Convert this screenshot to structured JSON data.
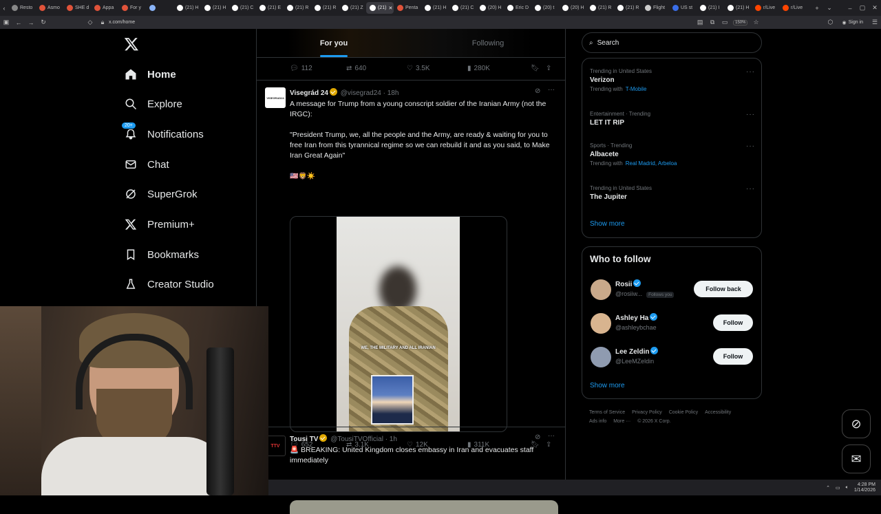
{
  "browser": {
    "tabs": [
      {
        "label": "Resto",
        "color": "#888"
      },
      {
        "label": "Asmo",
        "color": "#e0533a"
      },
      {
        "label": "SHE d",
        "color": "#e0533a"
      },
      {
        "label": "Appa",
        "color": "#e0533a"
      },
      {
        "label": "For y",
        "color": "#e0533a"
      },
      {
        "label": "",
        "color": "#8ab4f8"
      },
      {
        "label": "(21) H",
        "color": "#fff"
      },
      {
        "label": "(21) H",
        "color": "#fff"
      },
      {
        "label": "(21) C",
        "color": "#fff"
      },
      {
        "label": "(21) E",
        "color": "#fff"
      },
      {
        "label": "(21) R",
        "color": "#fff"
      },
      {
        "label": "(21) R",
        "color": "#fff"
      },
      {
        "label": "(21) Z",
        "color": "#fff"
      },
      {
        "label": "(21)",
        "color": "#fff",
        "active": true
      },
      {
        "label": "Penta",
        "color": "#e0533a"
      },
      {
        "label": "(21) H",
        "color": "#fff"
      },
      {
        "label": "(21) C",
        "color": "#fff"
      },
      {
        "label": "(20) H",
        "color": "#fff"
      },
      {
        "label": "Eric D",
        "color": "#fff"
      },
      {
        "label": "(20) t",
        "color": "#fff"
      },
      {
        "label": "(20) H",
        "color": "#fff"
      },
      {
        "label": "(21) R",
        "color": "#fff"
      },
      {
        "label": "(21) R",
        "color": "#fff"
      },
      {
        "label": "Flight",
        "color": "#ccc"
      },
      {
        "label": "US st",
        "color": "#3a6ee8"
      },
      {
        "label": "(21) I",
        "color": "#fff"
      },
      {
        "label": "(21) H",
        "color": "#fff"
      },
      {
        "label": "r/Live",
        "color": "#ff4500"
      },
      {
        "label": "r/Live",
        "color": "#ff4500"
      }
    ],
    "url": "x.com/home",
    "zoom": "150%",
    "signin": "Sign in"
  },
  "nav": {
    "items": [
      {
        "label": "Home",
        "icon": "home-icon"
      },
      {
        "label": "Explore",
        "icon": "search-icon"
      },
      {
        "label": "Notifications",
        "icon": "bell-icon",
        "badge": "20+"
      },
      {
        "label": "Chat",
        "icon": "mail-icon"
      },
      {
        "label": "SuperGrok",
        "icon": "grok-icon"
      },
      {
        "label": "Premium+",
        "icon": "x-icon"
      },
      {
        "label": "Bookmarks",
        "icon": "bookmark-icon"
      },
      {
        "label": "Creator Studio",
        "icon": "flask-icon"
      }
    ]
  },
  "feed": {
    "tabs": [
      "For you",
      "Following"
    ],
    "prev_actions": {
      "replies": "112",
      "reposts": "640",
      "likes": "3.5K",
      "views": "280K"
    },
    "post1": {
      "name": "Visegrád 24",
      "handle": "@visegrad24",
      "time": "· 18h",
      "avatar_text": "VISEGRAD24",
      "text1": "A message for Trump from a young conscript soldier of the Iranian Army (not the IRGC):",
      "text2": "\"President Trump, we, all the people and the Army, are ready & waiting for you to free Iran from this tyrannical regime so we can rebuild it and as you said, to Make Iran Great Again\"",
      "emojis": "🇺🇸🦁☀️",
      "video_caption": "WE, THE MILITARY AND ALL IRANIAN",
      "actions": {
        "replies": "652",
        "reposts": "3.1K",
        "likes": "12K",
        "views": "311K"
      }
    },
    "post2": {
      "name": "Tousi TV",
      "handle": "@TousiTVOfficial",
      "time": "· 1h",
      "avatar_text": "TTV",
      "text": "🚨 BREAKING: United Kingdom closes embassy in Iran and evacuates staff immediately"
    }
  },
  "sidebar": {
    "search_placeholder": "Search",
    "trends": [
      {
        "meta": "Trending in United States",
        "title": "Verizon",
        "sub_prefix": "Trending with",
        "sub_link": "T-Mobile"
      },
      {
        "meta": "Entertainment · Trending",
        "title": "LET IT RIP",
        "sub_prefix": "",
        "sub_link": ""
      },
      {
        "meta": "Sports · Trending",
        "title": "Albacete",
        "sub_prefix": "Trending with",
        "sub_link": "Real Madrid, Arbeloa"
      },
      {
        "meta": "Trending in United States",
        "title": "The Jupiter",
        "sub_prefix": "",
        "sub_link": ""
      }
    ],
    "show_more": "Show more",
    "who_to_follow": {
      "title": "Who to follow",
      "accounts": [
        {
          "name": "Rosii",
          "handle": "@rosiiw...",
          "follows_you": "Follows you",
          "button": "Follow back",
          "avatar_color": "#c9a98a"
        },
        {
          "name": "Ashley Ha",
          "handle": "@ashleybchae",
          "follows_you": "",
          "button": "Follow",
          "avatar_color": "#d8b48f"
        },
        {
          "name": "Lee Zeldin",
          "handle": "@LeeMZeldin",
          "follows_you": "",
          "button": "Follow",
          "avatar_color": "#8f9bb0"
        }
      ],
      "show_more": "Show more"
    },
    "footer": [
      "Terms of Service",
      "Privacy Policy",
      "Cookie Policy",
      "Accessibility",
      "Ads info",
      "More ···",
      "© 2026 X Corp."
    ]
  },
  "taskbar": {
    "time": "4:28 PM",
    "date": "1/14/2026"
  }
}
